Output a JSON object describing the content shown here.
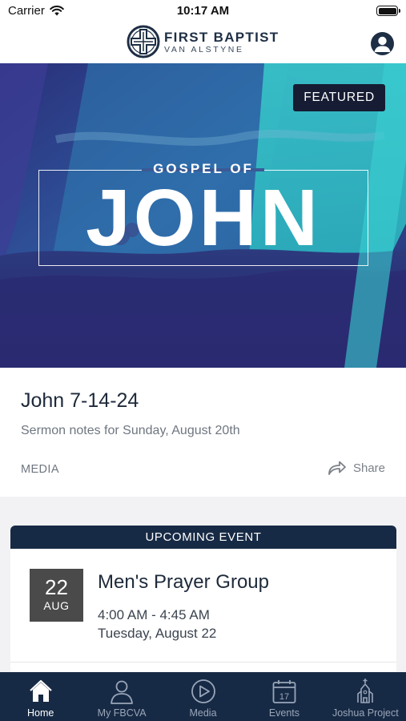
{
  "status_bar": {
    "carrier": "Carrier",
    "time": "10:17 AM"
  },
  "header": {
    "logo_title": "FIRST BAPTIST",
    "logo_subtitle": "VAN ALSTYNE",
    "profile_icon": "user-circle-icon"
  },
  "hero": {
    "badge": "FEATURED",
    "kicker": "GOSPEL OF",
    "title": "JOHN"
  },
  "featured": {
    "title": "John 7-14-24",
    "subtitle": "Sermon notes for Sunday, August 20th",
    "category": "MEDIA",
    "share_label": "Share",
    "share_icon": "share-arrow-icon"
  },
  "event": {
    "header": "UPCOMING EVENT",
    "day": "22",
    "month": "AUG",
    "title": "Men's Prayer Group",
    "time": "4:00 AM - 4:45 AM",
    "date": "Tuesday, August 22"
  },
  "tabs": [
    {
      "label": "Home",
      "icon": "home-icon",
      "active": true
    },
    {
      "label": "My FBCVA",
      "icon": "person-icon",
      "active": false
    },
    {
      "label": "Media",
      "icon": "play-circle-icon",
      "active": false
    },
    {
      "label": "Events",
      "icon": "calendar-icon",
      "active": false,
      "calendar_day": "17"
    },
    {
      "label": "Joshua Project",
      "icon": "church-icon",
      "active": false
    }
  ],
  "colors": {
    "navy": "#172a45",
    "hero_purple": "#2b2d78",
    "hero_teal": "#2fc4c8",
    "date_box": "#4a4a4a"
  }
}
